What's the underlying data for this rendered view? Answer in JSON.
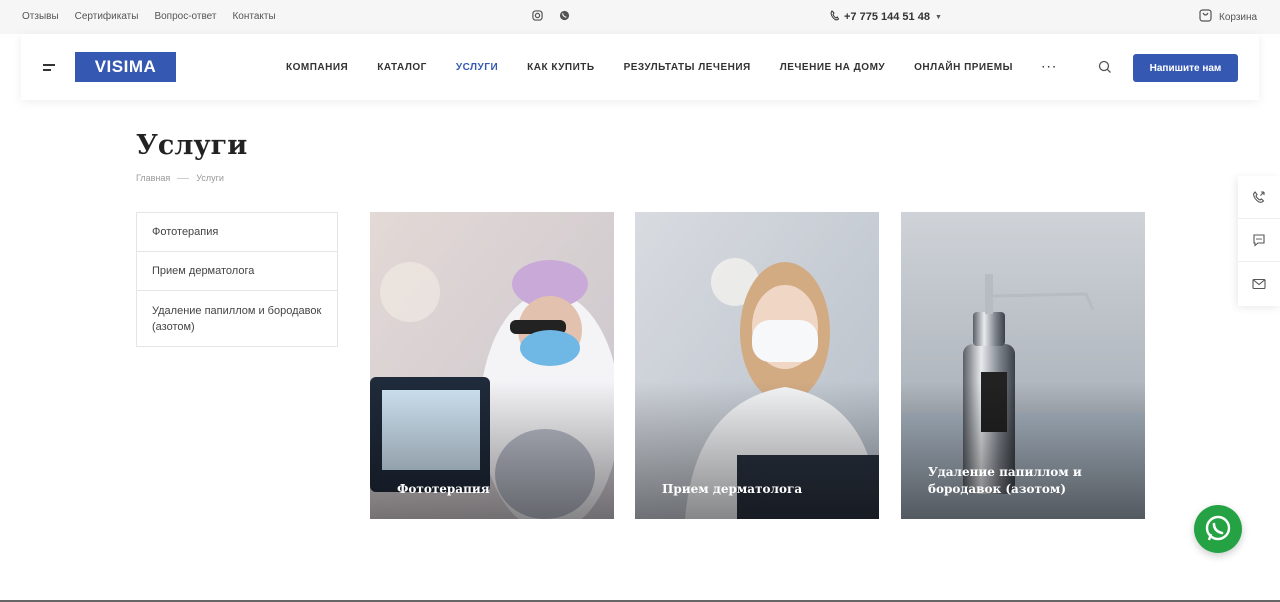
{
  "top_links": [
    "Отзывы",
    "Сертификаты",
    "Вопрос-ответ",
    "Контакты"
  ],
  "phone": "+7 775 144 51 48",
  "cart_label": "Корзина",
  "logo": "VISIMA",
  "nav": [
    "КОМПАНИЯ",
    "КАТАЛОГ",
    "УСЛУГИ",
    "КАК КУПИТЬ",
    "РЕЗУЛЬТАТЫ ЛЕЧЕНИЯ",
    "ЛЕЧЕНИЕ НА ДОМУ",
    "ОНЛАЙН ПРИЕМЫ"
  ],
  "nav_more": "···",
  "cta_label": "Напишите нам",
  "page_title": "Услуги",
  "breadcrumb": [
    "Главная",
    "Услуги"
  ],
  "side_menu": [
    "Фототерапия",
    "Прием дерматолога",
    "Удаление папиллом и бородавок (азотом)"
  ],
  "cards": [
    "Фототерапия",
    "Прием дерматолога",
    "Удаление папиллом и бородавок (азотом)"
  ],
  "colors": {
    "accent": "#3558b2",
    "whatsapp": "#25a244"
  },
  "icons": [
    "instagram-icon",
    "whatsapp-icon",
    "phone-icon",
    "cart-icon",
    "search-icon",
    "callback-icon",
    "chat-icon",
    "mail-icon"
  ]
}
